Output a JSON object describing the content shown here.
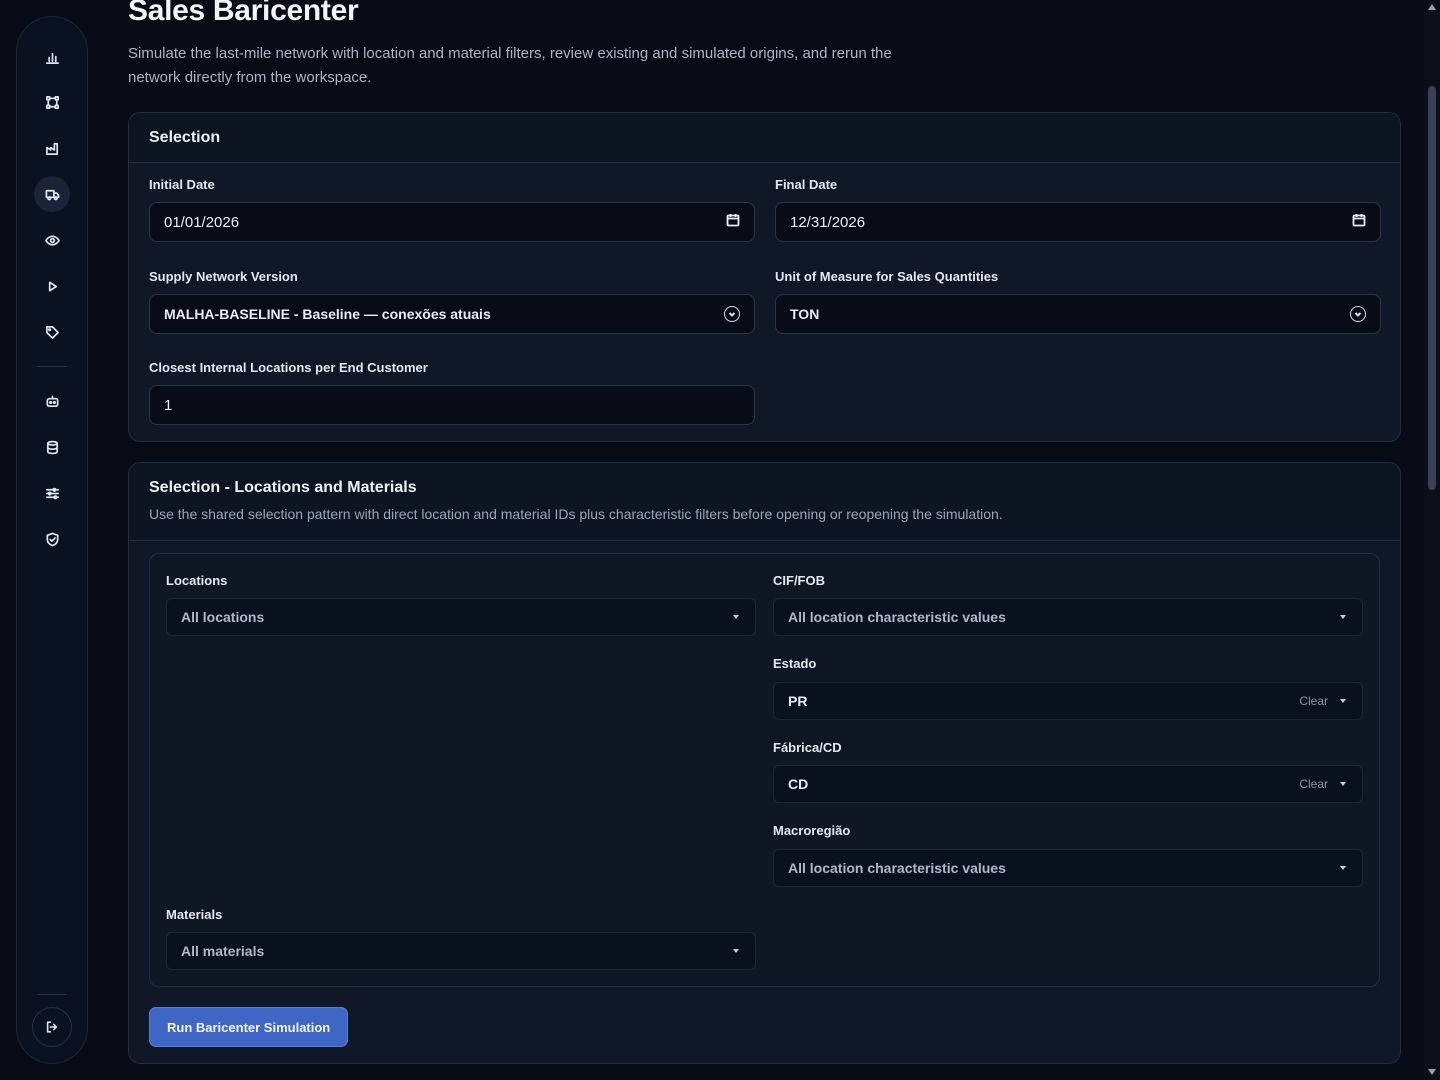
{
  "header": {
    "title": "Sales Baricenter",
    "description": "Simulate the last-mile network with location and material filters, review existing and simulated origins, and rerun the network directly from the workspace."
  },
  "sidebar": {
    "items": [
      {
        "icon": "bar-chart-icon"
      },
      {
        "icon": "network-icon"
      },
      {
        "icon": "factory-icon"
      },
      {
        "icon": "truck-icon",
        "active": true
      },
      {
        "icon": "eye-icon"
      },
      {
        "icon": "play-icon"
      },
      {
        "icon": "tag-icon"
      },
      {
        "icon": "robot-icon"
      },
      {
        "icon": "database-icon"
      },
      {
        "icon": "sliders-icon"
      },
      {
        "icon": "shield-check-icon"
      }
    ],
    "logout_icon": "logout-icon"
  },
  "selection": {
    "title": "Selection",
    "initial_date": {
      "label": "Initial Date",
      "value": "01/01/2026"
    },
    "final_date": {
      "label": "Final Date",
      "value": "12/31/2026"
    },
    "network_version": {
      "label": "Supply Network Version",
      "value": "MALHA-BASELINE - Baseline — conexões atuais"
    },
    "unit": {
      "label": "Unit of Measure for Sales Quantities",
      "value": "TON"
    },
    "closest": {
      "label": "Closest Internal Locations per End Customer",
      "value": "1"
    }
  },
  "locmat": {
    "title": "Selection - Locations and Materials",
    "subtitle": "Use the shared selection pattern with direct location and material IDs plus characteristic filters before opening or reopening the simulation.",
    "locations": {
      "label": "Locations",
      "value": "All locations"
    },
    "cif_fob": {
      "label": "CIF/FOB",
      "value": "All location characteristic values"
    },
    "estado": {
      "label": "Estado",
      "value": "PR",
      "clear": "Clear"
    },
    "fabrica": {
      "label": "Fábrica/CD",
      "value": "CD",
      "clear": "Clear"
    },
    "macroregiao": {
      "label": "Macroregião",
      "value": "All location characteristic values"
    },
    "materials": {
      "label": "Materials",
      "value": "All materials"
    },
    "run_button": "Run Baricenter Simulation"
  },
  "colors": {
    "background": "#060b16",
    "card": "#101726",
    "accent": "#3f66c4"
  }
}
